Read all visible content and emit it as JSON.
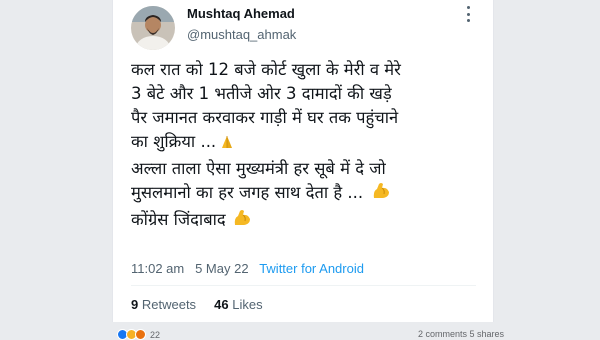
{
  "tweet": {
    "name": "Mushtaq Ahemad",
    "handle": "@mushtaq_ahmak",
    "lines": [
      "कल रात को 12 बजे कोर्ट खुला के मेरी व मेरे",
      "3 बेटे और 1 भतीजे ओर 3 दामादों की खड़े",
      "पैर जमानत करवाकर गाड़ी में घर तक पहुंचाने",
      "का शुक्रिया ...",
      "अल्ला ताला ऐसा मुख्यमंत्री हर सूबे में दे जो",
      "मुसलमानो का हर जगह साथ देता है ...",
      "कोंग्रेस जिंदाबाद"
    ],
    "time": "11:02 am",
    "date": "5 May 22",
    "source": "Twitter for Android",
    "retweets_count": "9",
    "retweets_label": "Retweets",
    "likes_count": "46",
    "likes_label": "Likes"
  },
  "footer": {
    "reactions_count": "22",
    "comments_shares": "2 comments 5 shares"
  },
  "icons": {
    "more": "more-vertical-icon",
    "prayer": "folded-hands-emoji",
    "muscle": "flexed-biceps-emoji"
  },
  "colors": {
    "link": "#1d9bf0",
    "muted": "#536471",
    "emoji": "#f5b823"
  }
}
